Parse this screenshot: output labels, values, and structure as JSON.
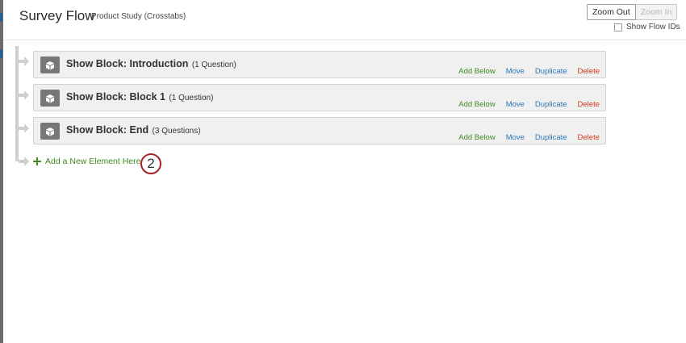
{
  "header": {
    "title": "Survey Flow",
    "subtitle": "Product Study (Crosstabs)",
    "zoom_out_label": "Zoom Out",
    "zoom_in_label": "Zoom In",
    "show_flow_ids_label": "Show Flow IDs",
    "show_flow_ids_checked": false,
    "zoom_in_enabled": false
  },
  "flow": {
    "blocks": [
      {
        "name": "Show Block: Introduction",
        "count": "(1 Question)",
        "icon": "cube-icon"
      },
      {
        "name": "Show Block: Block 1",
        "count": "(1 Question)",
        "icon": "cube-icon"
      },
      {
        "name": "Show Block: End",
        "count": "(3 Questions)",
        "icon": "cube-icon"
      }
    ],
    "actions": {
      "add_below": "Add Below",
      "move": "Move",
      "duplicate": "Duplicate",
      "delete": "Delete"
    },
    "add_element_label": "Add a New Element Here",
    "add_element_icon": "plus-icon"
  },
  "annotation": {
    "step_number": "2"
  },
  "colors": {
    "add_green": "#3d8b1f",
    "link_blue": "#2a76b8",
    "delete_red": "#cf3b1e",
    "badge_red": "#a8232d",
    "block_bg": "#f0f0f0",
    "connector_gray": "#cfcfcf"
  }
}
